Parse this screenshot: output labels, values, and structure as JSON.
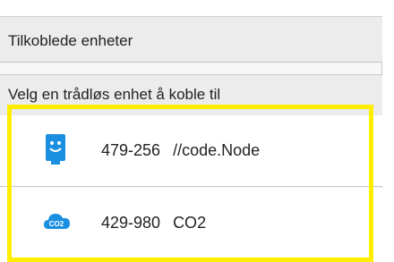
{
  "sections": {
    "connected_title": "Tilkoblede enheter",
    "choose_title": "Velg en trådløs enhet å koble til"
  },
  "devices": [
    {
      "id": "479-256",
      "name": "//code.Node",
      "icon": "code-node-icon"
    },
    {
      "id": "429-980",
      "name": "CO2",
      "icon": "co2-cloud-icon"
    }
  ],
  "icon_text": {
    "co2": "CO2"
  },
  "colors": {
    "highlight": "#ffee00",
    "icon_blue": "#1a8fe0",
    "header_bg": "#ececec"
  }
}
